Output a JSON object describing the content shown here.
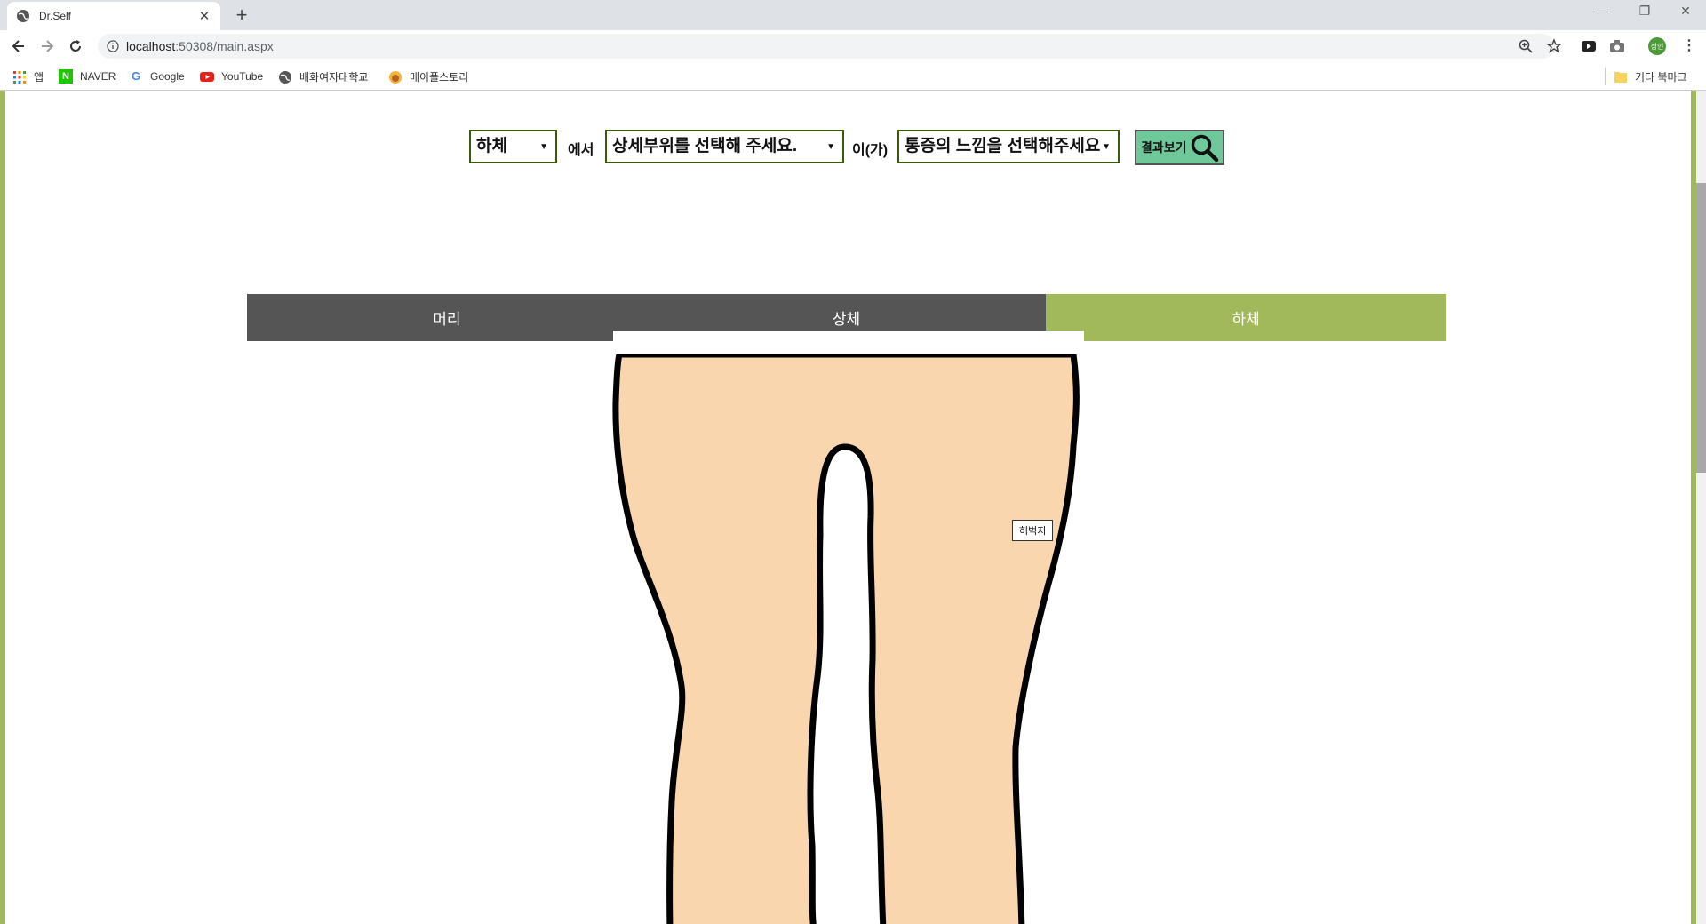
{
  "browser": {
    "tab_title": "Dr.Self",
    "url_host": "localhost",
    "url_path": ":50308/main.aspx",
    "bookmarks": [
      {
        "label": "앱",
        "icon": "apps-grid-icon"
      },
      {
        "label": "NAVER",
        "icon": "naver-icon"
      },
      {
        "label": "Google",
        "icon": "google-icon"
      },
      {
        "label": "YouTube",
        "icon": "youtube-icon"
      },
      {
        "label": "배화여자대학교",
        "icon": "globe-icon"
      },
      {
        "label": "메이플스토리",
        "icon": "maplestory-icon"
      }
    ],
    "other_bookmarks": "기타 북마크",
    "profile_initial": "정인"
  },
  "search": {
    "part_value": "하체",
    "connector1": "에서",
    "detail_value": "상세부위를 선택해 주세요.",
    "connector2": "이(가)",
    "feeling_value": "통증의 느낌을 선택해주세요",
    "result_label": "결과보기"
  },
  "body_tabs": [
    {
      "label": "머리",
      "active": false
    },
    {
      "label": "상체",
      "active": false
    },
    {
      "label": "하체",
      "active": true
    }
  ],
  "tooltip": "허벅지",
  "colors": {
    "accent": "#a2b95b",
    "tab_inactive": "#555555",
    "skin": "#f9d6ad",
    "result_button": "#6fc89a"
  }
}
